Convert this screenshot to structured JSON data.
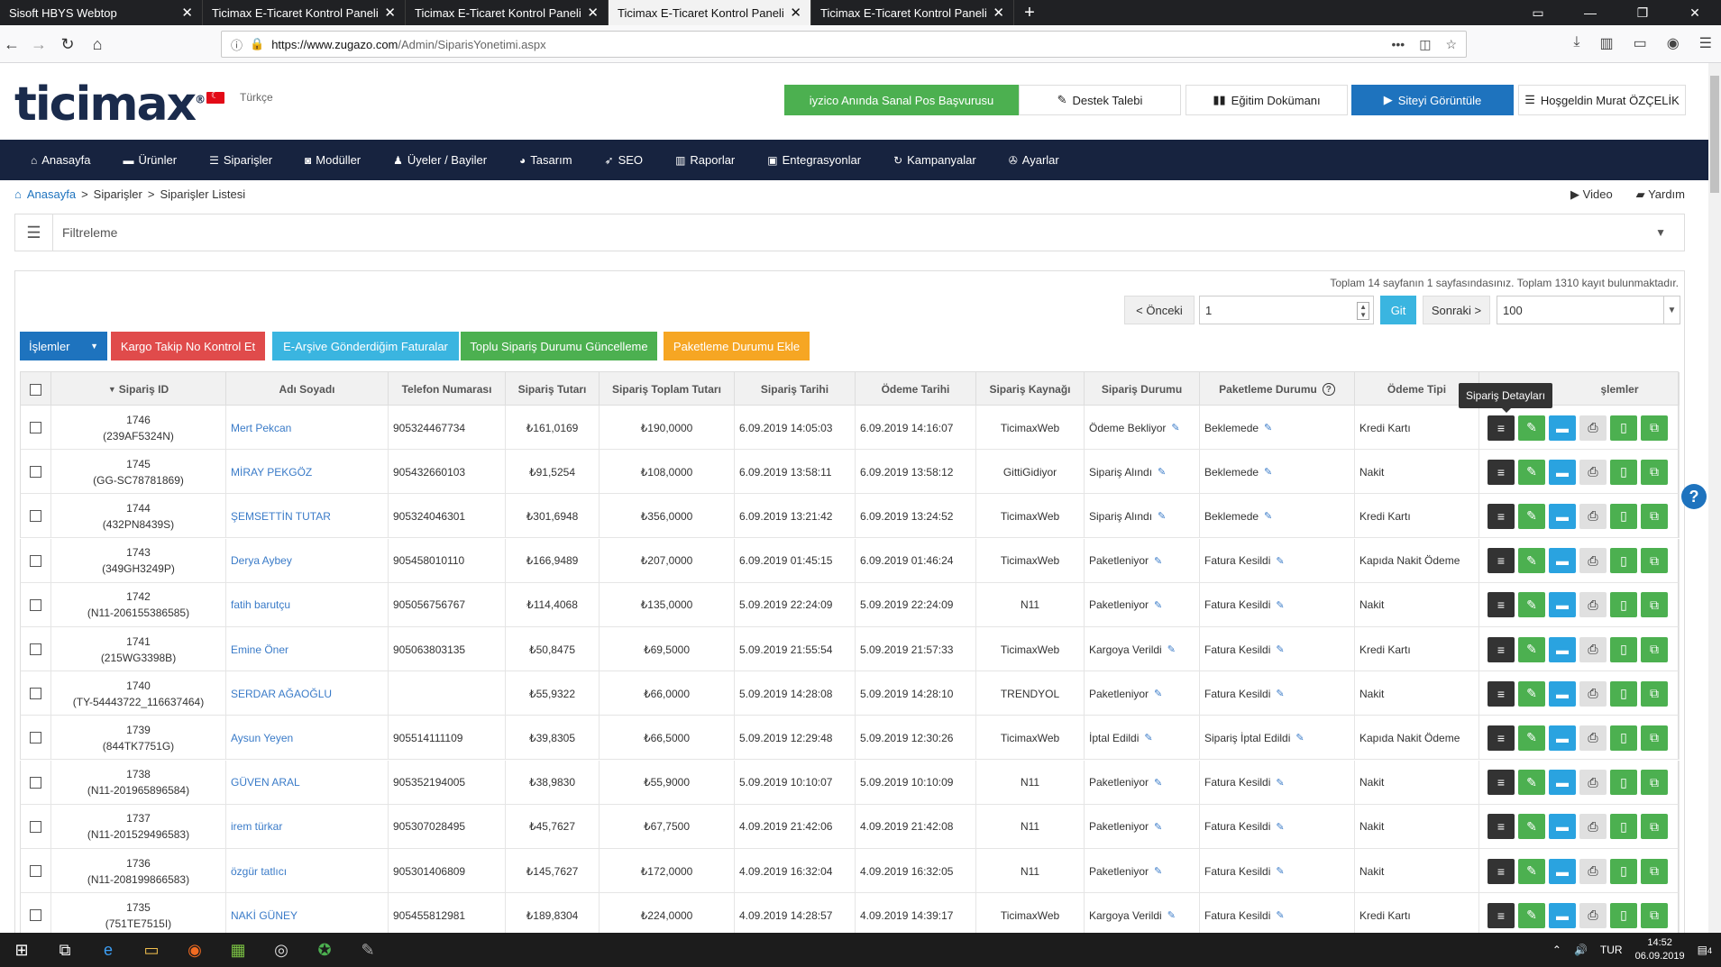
{
  "browser": {
    "tabs": [
      {
        "title": "Sisoft HBYS Webtop",
        "active": false
      },
      {
        "title": "Ticimax E-Ticaret Kontrol Paneli",
        "active": false
      },
      {
        "title": "Ticimax E-Ticaret Kontrol Paneli",
        "active": false
      },
      {
        "title": "Ticimax E-Ticaret Kontrol Paneli",
        "active": true
      },
      {
        "title": "Ticimax E-Ticaret Kontrol Paneli",
        "active": false
      }
    ],
    "url_host": "https://www.zugazo.com",
    "url_path": "/Admin/SiparisYonetimi.aspx"
  },
  "header": {
    "logo": "ticimax",
    "language": "Türkçe",
    "btn_iyzico": "iyzico Anında Sanal Pos Başvurusu",
    "btn_support": "Destek Talebi",
    "btn_docs": "Eğitim Dokümanı",
    "btn_view_site": "Siteyi Görüntüle",
    "btn_welcome": "Hoşgeldin Murat ÖZÇELİK"
  },
  "mainnav": [
    {
      "label": "Anasayfa",
      "icon": "home-icon"
    },
    {
      "label": "Ürünler",
      "icon": "folder-icon"
    },
    {
      "label": "Siparişler",
      "icon": "list-icon"
    },
    {
      "label": "Modüller",
      "icon": "camera-icon"
    },
    {
      "label": "Üyeler / Bayiler",
      "icon": "user-icon"
    },
    {
      "label": "Tasarım",
      "icon": "palette-icon"
    },
    {
      "label": "SEO",
      "icon": "rocket-icon"
    },
    {
      "label": "Raporlar",
      "icon": "chart-icon"
    },
    {
      "label": "Entegrasyonlar",
      "icon": "integration-icon"
    },
    {
      "label": "Kampanyalar",
      "icon": "refresh-icon"
    },
    {
      "label": "Ayarlar",
      "icon": "wrench-icon"
    }
  ],
  "breadcrumb": {
    "home": "Anasayfa",
    "orders": "Siparişler",
    "list": "Siparişler Listesi",
    "sep": ">"
  },
  "helpers": {
    "video": "Video",
    "help": "Yardım"
  },
  "filter": {
    "label": "Filtreleme"
  },
  "pagination": {
    "info": "Toplam 14 sayfanın 1 sayfasındasınız. Toplam 1310 kayıt bulunmaktadır.",
    "prev": "< Önceki",
    "page": "1",
    "go": "Git",
    "next": "Sonraki >",
    "per_page": "100"
  },
  "actions": {
    "islemler": "İşlemler",
    "kargo": "Kargo Takip No Kontrol Et",
    "earsiv": "E-Arşive Gönderdiğim Faturalar",
    "toplu": "Toplu Sipariş Durumu Güncelleme",
    "paketleme": "Paketleme Durumu Ekle"
  },
  "colors": {
    "red": "#e04b4b",
    "teal": "#3ab5e0",
    "green": "#4cb050",
    "orange": "#f6a623",
    "blue": "#1e73be",
    "navy": "#17233f"
  },
  "columns": [
    "Sipariş ID",
    "Adı Soyadı",
    "Telefon Numarası",
    "Sipariş Tutarı",
    "Sipariş Toplam Tutarı",
    "Sipariş Tarihi",
    "Ödeme Tarihi",
    "Sipariş Kaynağı",
    "Sipariş Durumu",
    "Paketleme Durumu",
    "Ödeme Tipi",
    "İşlemler"
  ],
  "ops_header_visible": "şlemler",
  "tooltip": "Sipariş Detayları",
  "rows": [
    {
      "id": "1746",
      "code": "(239AF5324N)",
      "name": "Mert Pekcan",
      "phone": "905324467734",
      "amount": "₺161,0169",
      "total": "₺190,0000",
      "date": "6.09.2019 14:05:03",
      "paydate": "6.09.2019 14:16:07",
      "source": "TicimaxWeb",
      "status": "Ödeme Bekliyor",
      "pack": "Beklemede",
      "paytype": "Kredi Kartı"
    },
    {
      "id": "1745",
      "code": "(GG-SC78781869)",
      "name": "MİRAY PEKGÖZ",
      "phone": "905432660103",
      "amount": "₺91,5254",
      "total": "₺108,0000",
      "date": "6.09.2019 13:58:11",
      "paydate": "6.09.2019 13:58:12",
      "source": "GittiGidiyor",
      "status": "Sipariş Alındı",
      "pack": "Beklemede",
      "paytype": "Nakit"
    },
    {
      "id": "1744",
      "code": "(432PN8439S)",
      "name": "ŞEMSETTİN TUTAR",
      "phone": "905324046301",
      "amount": "₺301,6948",
      "total": "₺356,0000",
      "date": "6.09.2019 13:21:42",
      "paydate": "6.09.2019 13:24:52",
      "source": "TicimaxWeb",
      "status": "Sipariş Alındı",
      "pack": "Beklemede",
      "paytype": "Kredi Kartı"
    },
    {
      "id": "1743",
      "code": "(349GH3249P)",
      "name": "Derya Aybey",
      "phone": "905458010110",
      "amount": "₺166,9489",
      "total": "₺207,0000",
      "date": "6.09.2019 01:45:15",
      "paydate": "6.09.2019 01:46:24",
      "source": "TicimaxWeb",
      "status": "Paketleniyor",
      "pack": "Fatura Kesildi",
      "paytype": "Kapıda Nakit Ödeme"
    },
    {
      "id": "1742",
      "code": "(N11-206155386585)",
      "name": "fatih barutçu",
      "phone": "905056756767",
      "amount": "₺114,4068",
      "total": "₺135,0000",
      "date": "5.09.2019 22:24:09",
      "paydate": "5.09.2019 22:24:09",
      "source": "N11",
      "status": "Paketleniyor",
      "pack": "Fatura Kesildi",
      "paytype": "Nakit"
    },
    {
      "id": "1741",
      "code": "(215WG3398B)",
      "name": "Emine Öner",
      "phone": "905063803135",
      "amount": "₺50,8475",
      "total": "₺69,5000",
      "date": "5.09.2019 21:55:54",
      "paydate": "5.09.2019 21:57:33",
      "source": "TicimaxWeb",
      "status": "Kargoya Verildi",
      "pack": "Fatura Kesildi",
      "paytype": "Kredi Kartı"
    },
    {
      "id": "1740",
      "code": "(TY-54443722_116637464)",
      "name": "SERDAR AĞAOĞLU",
      "phone": "",
      "amount": "₺55,9322",
      "total": "₺66,0000",
      "date": "5.09.2019 14:28:08",
      "paydate": "5.09.2019 14:28:10",
      "source": "TRENDYOL",
      "status": "Paketleniyor",
      "pack": "Fatura Kesildi",
      "paytype": "Nakit"
    },
    {
      "id": "1739",
      "code": "(844TK7751G)",
      "name": "Aysun Yeyen",
      "phone": "905514111109",
      "amount": "₺39,8305",
      "total": "₺66,5000",
      "date": "5.09.2019 12:29:48",
      "paydate": "5.09.2019 12:30:26",
      "source": "TicimaxWeb",
      "status": "İptal Edildi",
      "pack": "Sipariş İptal Edildi",
      "paytype": "Kapıda Nakit Ödeme"
    },
    {
      "id": "1738",
      "code": "(N11-201965896584)",
      "name": "GÜVEN ARAL",
      "phone": "905352194005",
      "amount": "₺38,9830",
      "total": "₺55,9000",
      "date": "5.09.2019 10:10:07",
      "paydate": "5.09.2019 10:10:09",
      "source": "N11",
      "status": "Paketleniyor",
      "pack": "Fatura Kesildi",
      "paytype": "Nakit"
    },
    {
      "id": "1737",
      "code": "(N11-201529496583)",
      "name": "irem türkar",
      "phone": "905307028495",
      "amount": "₺45,7627",
      "total": "₺67,7500",
      "date": "4.09.2019 21:42:06",
      "paydate": "4.09.2019 21:42:08",
      "source": "N11",
      "status": "Paketleniyor",
      "pack": "Fatura Kesildi",
      "paytype": "Nakit"
    },
    {
      "id": "1736",
      "code": "(N11-208199866583)",
      "name": "özgür tatlıcı",
      "phone": "905301406809",
      "amount": "₺145,7627",
      "total": "₺172,0000",
      "date": "4.09.2019 16:32:04",
      "paydate": "4.09.2019 16:32:05",
      "source": "N11",
      "status": "Paketleniyor",
      "pack": "Fatura Kesildi",
      "paytype": "Nakit"
    },
    {
      "id": "1735",
      "code": "(751TE7515I)",
      "name": "NAKİ GÜNEY",
      "phone": "905455812981",
      "amount": "₺189,8304",
      "total": "₺224,0000",
      "date": "4.09.2019 14:28:57",
      "paydate": "4.09.2019 14:39:17",
      "source": "TicimaxWeb",
      "status": "Kargoya Verildi",
      "pack": "Fatura Kesildi",
      "paytype": "Kredi Kartı"
    }
  ],
  "taskbar": {
    "lang": "TUR",
    "time": "14:52",
    "date": "06.09.2019",
    "notif": "4"
  }
}
